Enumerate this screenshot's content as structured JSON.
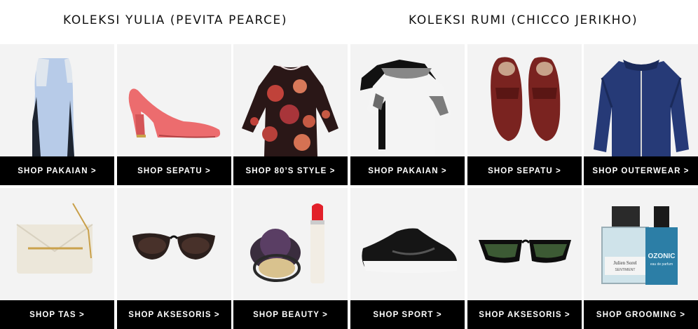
{
  "collections": [
    {
      "title": "KOLEKSI YULIA (PEVITA PEARCE)"
    },
    {
      "title": "KOLEKSI RUMI (CHICCO JERIKHO)"
    }
  ],
  "tiles": [
    {
      "label": "SHOP PAKAIAN >",
      "icon": "dress-icon"
    },
    {
      "label": "SHOP SEPATU >",
      "icon": "pump-shoe-icon"
    },
    {
      "label": "SHOP 80’S STYLE >",
      "icon": "floral-blouse-icon"
    },
    {
      "label": "SHOP PAKAIAN >",
      "icon": "tshirts-icon"
    },
    {
      "label": "SHOP SEPATU >",
      "icon": "loafers-icon"
    },
    {
      "label": "SHOP OUTERWEAR >",
      "icon": "bomber-jacket-icon"
    },
    {
      "label": "SHOP TAS >",
      "icon": "clutch-bag-icon"
    },
    {
      "label": "SHOP AKSESORIS >",
      "icon": "sunglasses-icon"
    },
    {
      "label": "SHOP BEAUTY >",
      "icon": "makeup-icon"
    },
    {
      "label": "SHOP SPORT >",
      "icon": "sneaker-icon"
    },
    {
      "label": "SHOP AKSESORIS >",
      "icon": "wayfarer-sunglasses-icon"
    },
    {
      "label": "SHOP GROOMING >",
      "icon": "perfume-icon"
    }
  ],
  "product_text": {
    "perfume_brand": "Julien Sorel",
    "perfume_sub": "SENTIMENT",
    "ozonic_name": "OZONIC",
    "ozonic_sub": "eau de parfum"
  },
  "colors": {
    "tile_bg": "#f3f3f3",
    "bar_bg": "#000000",
    "bar_text": "#ffffff",
    "title_text": "#111111"
  }
}
